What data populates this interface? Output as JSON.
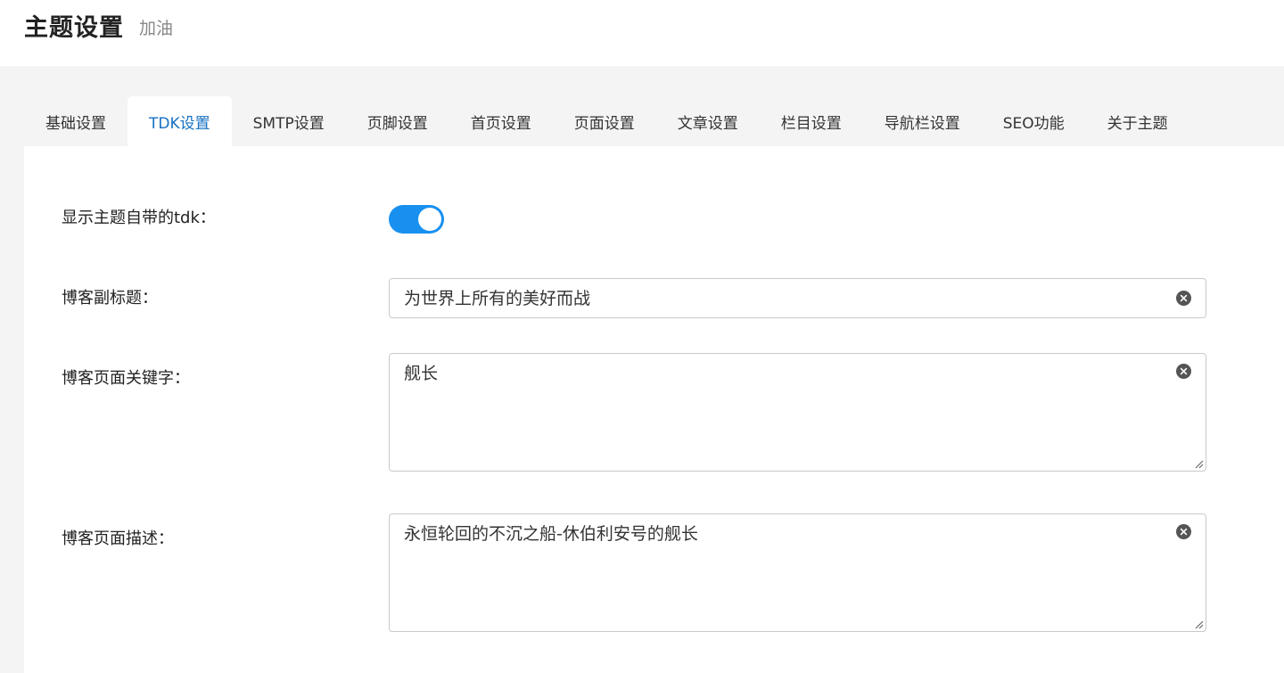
{
  "header": {
    "title": "主题设置",
    "subtitle": "加油"
  },
  "tabs": [
    {
      "label": "基础设置",
      "active": false
    },
    {
      "label": "TDK设置",
      "active": true
    },
    {
      "label": "SMTP设置",
      "active": false
    },
    {
      "label": "页脚设置",
      "active": false
    },
    {
      "label": "首页设置",
      "active": false
    },
    {
      "label": "页面设置",
      "active": false
    },
    {
      "label": "文章设置",
      "active": false
    },
    {
      "label": "栏目设置",
      "active": false
    },
    {
      "label": "导航栏设置",
      "active": false
    },
    {
      "label": "SEO功能",
      "active": false
    },
    {
      "label": "关于主题",
      "active": false
    }
  ],
  "settings": {
    "show_tdk": {
      "label": "显示主题自带的tdk：",
      "enabled": true
    },
    "subtitle": {
      "label": "博客副标题：",
      "value": "为世界上所有的美好而战"
    },
    "keywords": {
      "label": "博客页面关键字：",
      "value": "舰长"
    },
    "description": {
      "label": "博客页面描述：",
      "value": "永恒轮回的不沉之船-休伯利安号的舰长"
    }
  },
  "colors": {
    "accent": "#1890f0",
    "active_tab_text": "#1670c2",
    "background": "#f4f4f4"
  },
  "icons": {
    "clear": "clear-icon",
    "resize": "resize-handle-icon"
  }
}
